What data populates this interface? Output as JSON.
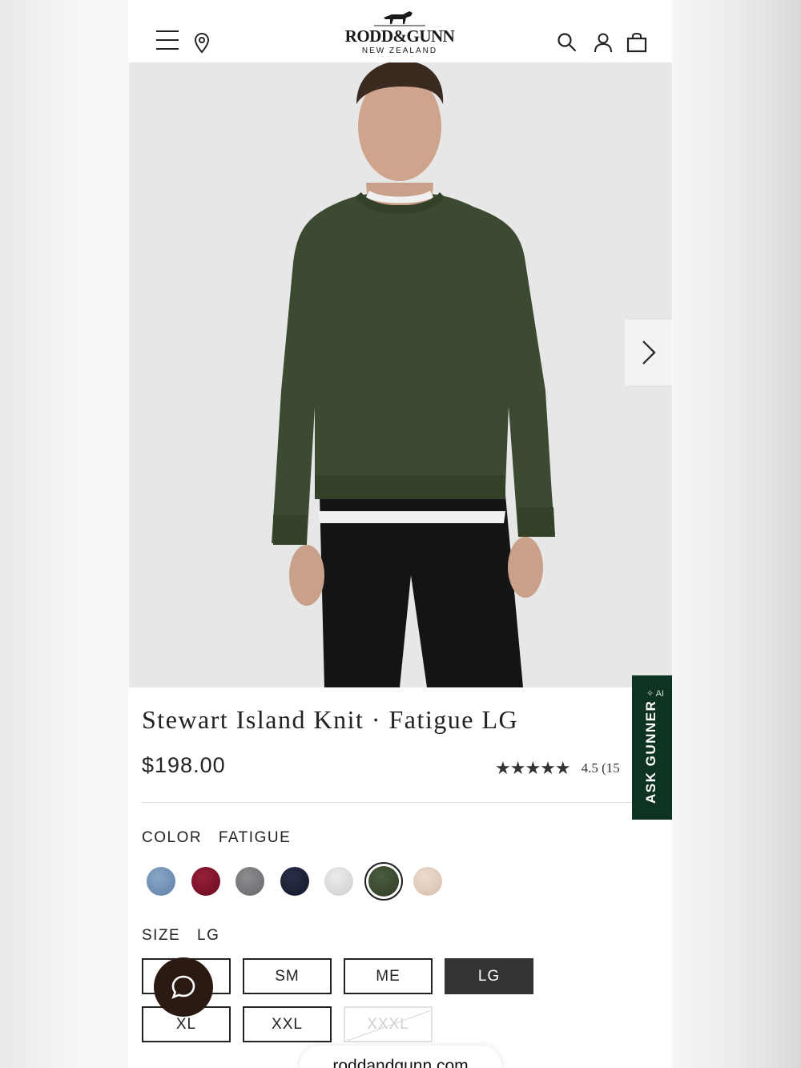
{
  "header": {
    "logo_main": "RODD&GUNN",
    "logo_sub": "NEW ZEALAND",
    "icons": [
      "menu-icon",
      "location-icon",
      "search-icon",
      "account-icon",
      "bag-icon"
    ]
  },
  "product": {
    "title": "Stewart Island Knit · Fatigue LG",
    "price": "$198.00",
    "rating_stars": "★★★★★",
    "rating_value": 4.5,
    "rating_text": "4.5 (15"
  },
  "color": {
    "label": "COLOR",
    "selected": "FATIGUE",
    "swatches": [
      {
        "name": "blue",
        "hex": "#6f8fb3"
      },
      {
        "name": "burgundy",
        "hex": "#7a0f26"
      },
      {
        "name": "grey",
        "hex": "#77787a"
      },
      {
        "name": "navy",
        "hex": "#1b2036"
      },
      {
        "name": "light-grey",
        "hex": "#dcdcdc"
      },
      {
        "name": "fatigue",
        "hex": "#3b4a30",
        "selected": true
      },
      {
        "name": "oatmeal",
        "hex": "#e3cfc0"
      }
    ]
  },
  "size": {
    "label": "SIZE",
    "selected": "LG",
    "options": [
      "",
      "SM",
      "ME",
      "LG",
      "XL",
      "XXL",
      "XXXL"
    ]
  },
  "ask_gunner": {
    "label": "ASK GUNNER",
    "badge": "AI"
  },
  "browser": {
    "url": "roddandgunn.com"
  },
  "colors": {
    "accent_green": "#0e3323",
    "chat_bubble": "#2b1a14",
    "selected_size_bg": "#333333"
  }
}
